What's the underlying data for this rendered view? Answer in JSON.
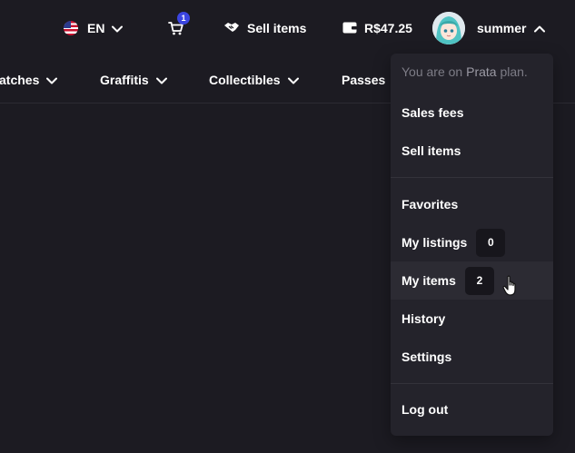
{
  "topbar": {
    "language": {
      "label": "EN",
      "flag": "us-flag-icon"
    },
    "cart": {
      "count": "1"
    },
    "sell": {
      "label": "Sell items"
    },
    "wallet": {
      "balance": "R$47.25"
    },
    "user": {
      "name": "summer"
    }
  },
  "nav": {
    "items": [
      {
        "label": "atches"
      },
      {
        "label": "Graffitis"
      },
      {
        "label": "Collectibles"
      },
      {
        "label": "Passes"
      }
    ]
  },
  "dropdown": {
    "plan_prefix": "You are on ",
    "plan_name": "Prata",
    "plan_suffix": " plan.",
    "items": [
      {
        "label": "Sales fees"
      },
      {
        "label": "Sell items"
      },
      {
        "label": "Favorites"
      },
      {
        "label": "My listings",
        "badge": "0"
      },
      {
        "label": "My items",
        "badge": "2"
      },
      {
        "label": "History"
      },
      {
        "label": "Settings"
      },
      {
        "label": "Log out"
      }
    ]
  },
  "colors": {
    "background": "#1c1b22",
    "dropdown": "#24232b",
    "badge": "#3b45e0",
    "muted": "#7d7c86"
  }
}
